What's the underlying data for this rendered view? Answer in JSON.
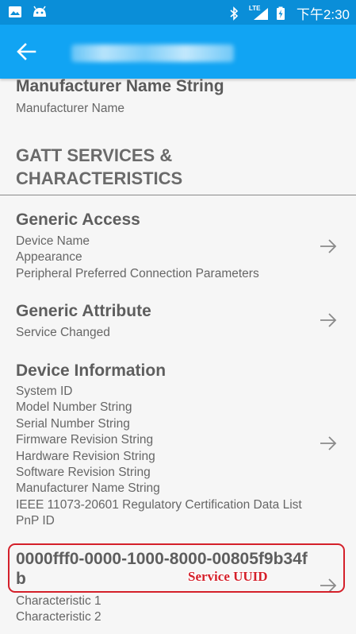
{
  "status_bar": {
    "time": "下午2:30",
    "network_label": "LTE",
    "icons": [
      "image-icon",
      "android-icon",
      "bluetooth-icon",
      "lte-signal-icon",
      "battery-charging-icon"
    ]
  },
  "app_bar": {
    "back_icon": "arrow-left-icon",
    "title_obscured": true
  },
  "top_item": {
    "title": "Manufacturer Name String",
    "subtitle": "Manufacturer Name"
  },
  "section": {
    "line1": "GATT SERVICES &",
    "line2": "CHARACTERISTICS"
  },
  "services": [
    {
      "name": "Generic Access",
      "characteristics": [
        "Device Name",
        "Appearance",
        "Peripheral Preferred Connection Parameters"
      ]
    },
    {
      "name": "Generic Attribute",
      "characteristics": [
        "Service Changed"
      ]
    },
    {
      "name": "Device Information",
      "characteristics": [
        "System ID",
        "Model Number String",
        "Serial Number String",
        "Firmware Revision String",
        "Hardware Revision String",
        "Software Revision String",
        "Manufacturer Name String",
        "IEEE 11073-20601 Regulatory Certification Data List",
        "PnP ID"
      ]
    },
    {
      "name_line1": "0000fff0-0000-1000-8000-00805f9b34f",
      "name_line2": "b",
      "characteristics": [
        "Characteristic 1",
        "Characteristic 2"
      ]
    }
  ],
  "annotation": {
    "label": "Service UUID",
    "color": "#d4202a"
  },
  "colors": {
    "status_bar": "#0a8ed8",
    "app_bar": "#11a4f3",
    "background": "#f6f6f6"
  }
}
